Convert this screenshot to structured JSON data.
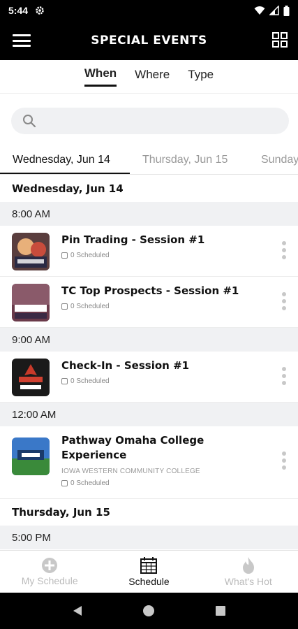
{
  "status": {
    "time": "5:44"
  },
  "header": {
    "title": "SPECIAL EVENTS"
  },
  "filter_tabs": [
    "When",
    "Where",
    "Type"
  ],
  "search": {
    "placeholder": ""
  },
  "day_tabs": [
    "Wednesday, Jun 14",
    "Thursday, Jun 15",
    "Sunday"
  ],
  "sections": {
    "wed": "Wednesday, Jun 14",
    "thu": "Thursday, Jun 15"
  },
  "times": [
    "8:00 AM",
    "9:00 AM",
    "12:00 AM",
    "5:00 PM"
  ],
  "events": [
    {
      "title": "Pin Trading - Session #1",
      "scheduled": "0 Scheduled"
    },
    {
      "title": "TC Top Prospects - Session #1",
      "scheduled": "0 Scheduled"
    },
    {
      "title": "Check-In - Session #1",
      "scheduled": "0 Scheduled"
    },
    {
      "title": "Pathway Omaha College Experience",
      "location": "IOWA WESTERN COMMUNITY COLLEGE",
      "scheduled": "0 Scheduled"
    }
  ],
  "bottom_nav": [
    {
      "label": "My Schedule",
      "icon": "plus-circle-icon"
    },
    {
      "label": "Schedule",
      "icon": "calendar-icon"
    },
    {
      "label": "What's Hot",
      "icon": "flame-icon"
    }
  ],
  "colors": {
    "bar": "#000000",
    "accent": "#111111",
    "muted": "#999999",
    "section_bg": "#f0f1f3"
  }
}
